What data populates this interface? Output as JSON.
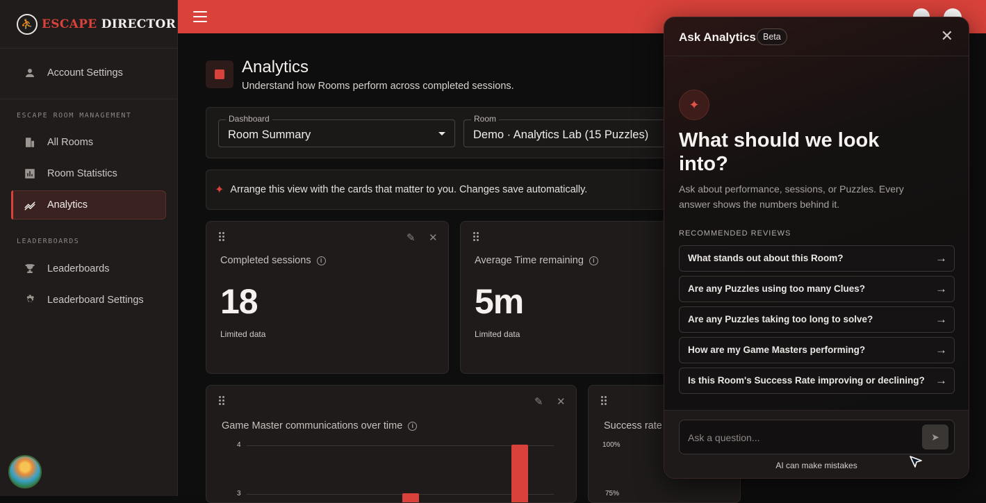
{
  "brand": {
    "part1": "ESCAPE",
    "part2": "DIRECTOR"
  },
  "sidebar": {
    "account": "Account Settings",
    "section1": "ESCAPE ROOM MANAGEMENT",
    "items1": [
      {
        "label": "All Rooms"
      },
      {
        "label": "Room Statistics"
      },
      {
        "label": "Analytics"
      }
    ],
    "section2": "LEADERBOARDS",
    "items2": [
      {
        "label": "Leaderboards"
      },
      {
        "label": "Leaderboard Settings"
      }
    ]
  },
  "page": {
    "title": "Analytics",
    "subtitle": "Understand how Rooms perform across completed sessions."
  },
  "filters": {
    "dashboard_label": "Dashboard",
    "dashboard_value": "Room Summary",
    "room_label": "Room",
    "room_value": "Demo · Analytics Lab (15 Puzzles)"
  },
  "info_bar": "Arrange this view with the cards that matter to you. Changes save automatically.",
  "cards": {
    "completed": {
      "title": "Completed sessions",
      "value": "18",
      "note": "Limited data"
    },
    "avg_time": {
      "title": "Average Time remaining",
      "value": "5m",
      "note": "Limited data"
    },
    "gm_comms": {
      "title": "Game Master communications over time",
      "y_ticks": [
        "4",
        "3"
      ]
    },
    "success": {
      "title": "Success rate",
      "y_ticks": [
        "100%",
        "75%"
      ]
    }
  },
  "chart_data": [
    {
      "type": "bar",
      "title": "Game Master communications over time",
      "ylim": [
        0,
        4
      ],
      "visible_values": [
        3,
        4
      ],
      "note": ""
    }
  ],
  "ask": {
    "title": "Ask Analytics",
    "badge": "Beta",
    "hero": "What should we look into?",
    "subtitle": "Ask about performance, sessions, or Puzzles. Every answer shows the numbers behind it.",
    "rec_label": "RECOMMENDED REVIEWS",
    "questions": [
      "What stands out about this Room?",
      "Are any Puzzles using too many Clues?",
      "Are any Puzzles taking too long to solve?",
      "How are my Game Masters performing?",
      "Is this Room's Success Rate improving or declining?"
    ],
    "placeholder": "Ask a question...",
    "disclaimer": "AI can make mistakes"
  },
  "colors": {
    "accent": "#d9423a",
    "background": "#0f0e0e",
    "sidebar": "#1f1c1b"
  }
}
